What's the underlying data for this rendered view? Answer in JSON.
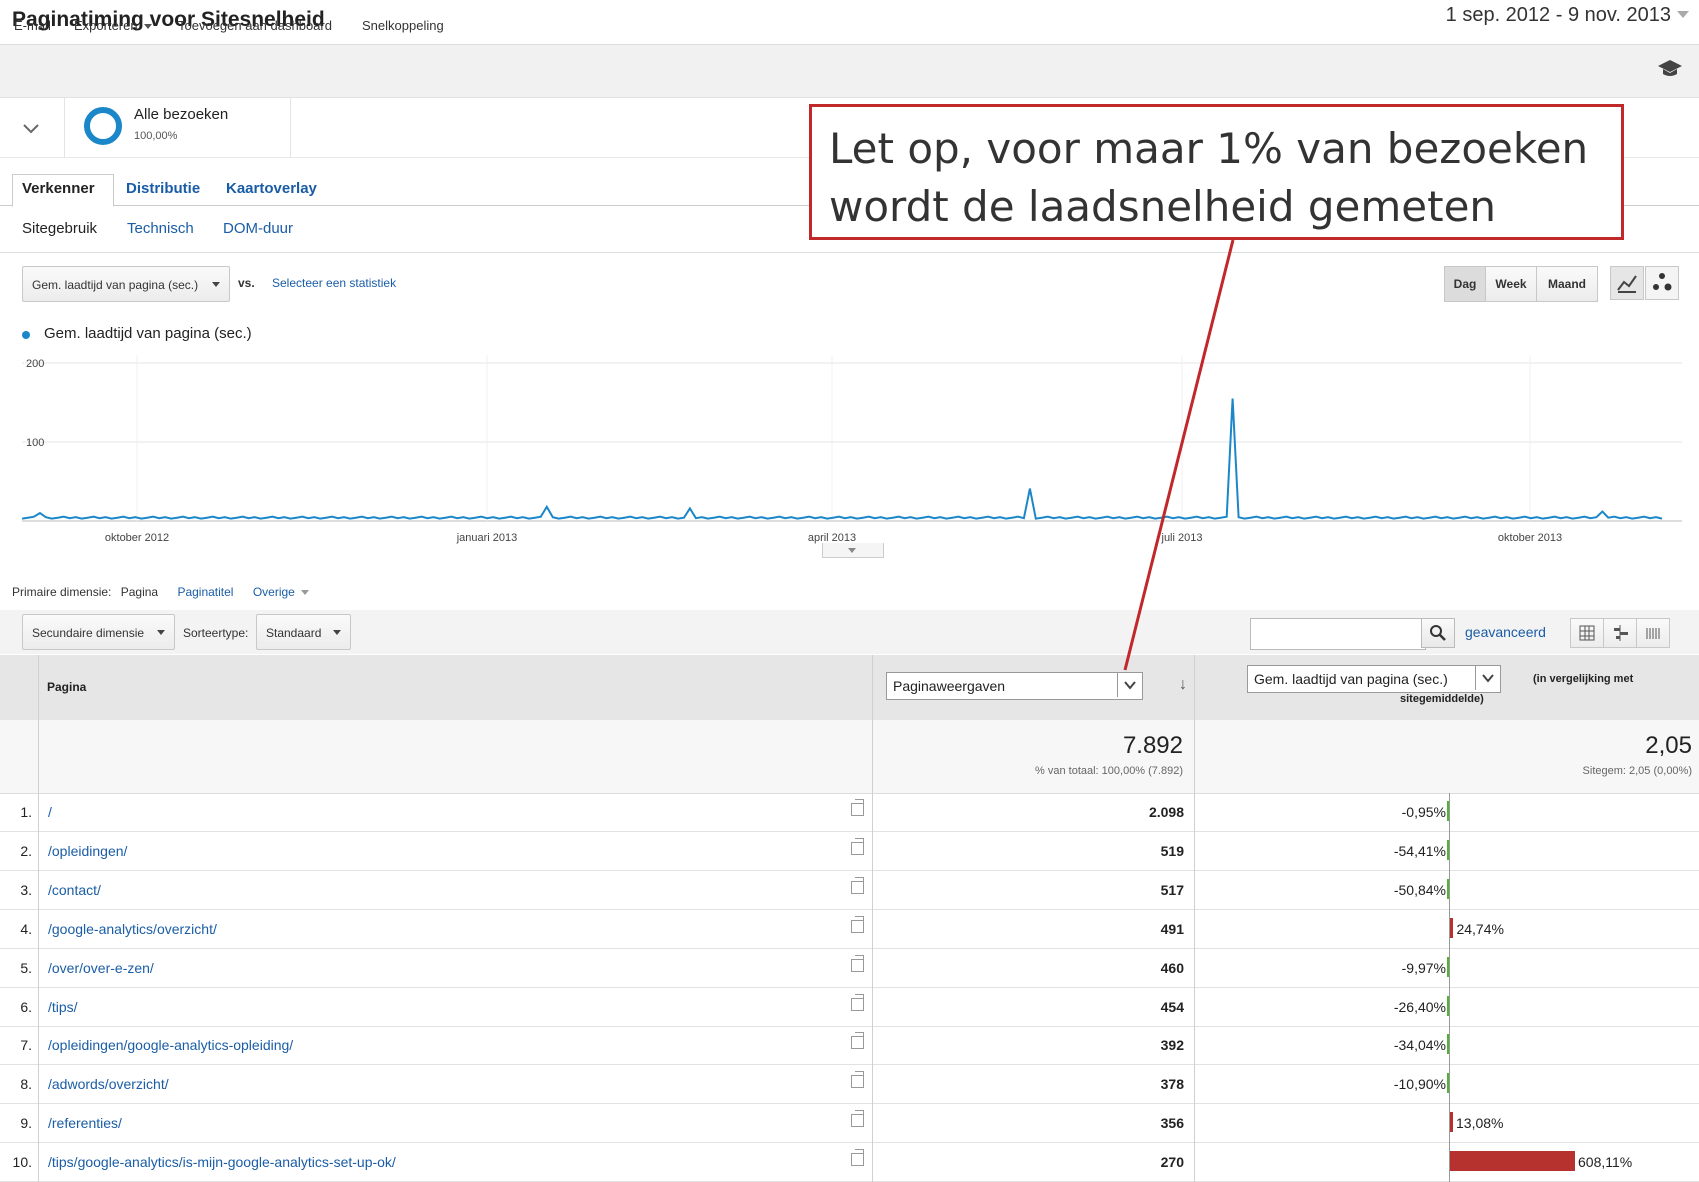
{
  "header": {
    "title": "Paginatiming voor Sitesnelheid",
    "date_range": "1 sep. 2012 - 9 nov. 2013"
  },
  "toolbar": {
    "email": "E-mail",
    "export": "Exporteren",
    "add_dashboard": "Toevoegen aan dashboard",
    "shortcut": "Snelkoppeling",
    "icon": "graduation-cap-icon"
  },
  "segment": {
    "name": "Alle bezoeken",
    "percent": "100,00%",
    "color": "#1b87c9"
  },
  "tabs": [
    "Verkenner",
    "Distributie",
    "Kaartoverlay"
  ],
  "subtabs": [
    "Sitegebruik",
    "Technisch",
    "DOM-duur"
  ],
  "chart_controls": {
    "metric": "Gem. laadtijd van pagina (sec.)",
    "vs": "vs.",
    "select_stat": "Selecteer een statistiek",
    "periods": [
      "Dag",
      "Week",
      "Maand"
    ],
    "active_period": "Dag"
  },
  "chart_data": {
    "type": "line",
    "series": [
      {
        "name": "Gem. laadtijd van pagina (sec.)",
        "color": "#1b87c9"
      }
    ],
    "yticks": [
      "200",
      "100"
    ],
    "ylim": [
      0,
      200
    ],
    "xlabels": [
      "oktober 2012",
      "januari 2013",
      "april 2013",
      "juli 2013",
      "oktober 2013"
    ],
    "baseline": 3,
    "spikes": [
      {
        "day": 16,
        "value": 10
      },
      {
        "day": 530,
        "value": 18
      },
      {
        "day": 672,
        "value": 16
      },
      {
        "day": 1012,
        "value": 41
      },
      {
        "day": 1217,
        "value": 155
      },
      {
        "day": 1592,
        "value": 12
      }
    ],
    "days": 1650
  },
  "dimensions": {
    "label": "Primaire dimensie:",
    "items": [
      "Pagina",
      "Paginatitel",
      "Overige"
    ]
  },
  "table_controls": {
    "secondary": "Secundaire dimensie",
    "sort_label": "Sorteertype:",
    "sort_value": "Standaard",
    "advanced": "geavanceerd"
  },
  "table": {
    "col_page": "Pagina",
    "col_pv": "Paginaweergaven",
    "col_lt": "Gem. laadtijd van pagina (sec.)",
    "col_lt_note": "(in vergelijking met",
    "col_lt_note2": "sitegemiddelde)",
    "total_pv": "7.892",
    "total_pv_sub": "% van totaal: 100,00% (7.892)",
    "total_lt": "2,05",
    "total_lt_sub": "Sitegem: 2,05 (0,00%)",
    "rows": [
      {
        "n": "1.",
        "page": "/",
        "pv": "2.098",
        "cmp": "-0,95%",
        "val": -0.95
      },
      {
        "n": "2.",
        "page": "/opleidingen/",
        "pv": "519",
        "cmp": "-54,41%",
        "val": -54.41
      },
      {
        "n": "3.",
        "page": "/contact/",
        "pv": "517",
        "cmp": "-50,84%",
        "val": -50.84
      },
      {
        "n": "4.",
        "page": "/google-analytics/overzicht/",
        "pv": "491",
        "cmp": "24,74%",
        "val": 24.74
      },
      {
        "n": "5.",
        "page": "/over/over-e-zen/",
        "pv": "460",
        "cmp": "-9,97%",
        "val": -9.97
      },
      {
        "n": "6.",
        "page": "/tips/",
        "pv": "454",
        "cmp": "-26,40%",
        "val": -26.4
      },
      {
        "n": "7.",
        "page": "/opleidingen/google-analytics-opleiding/",
        "pv": "392",
        "cmp": "-34,04%",
        "val": -34.04
      },
      {
        "n": "8.",
        "page": "/adwords/overzicht/",
        "pv": "378",
        "cmp": "-10,90%",
        "val": -10.9
      },
      {
        "n": "9.",
        "page": "/referenties/",
        "pv": "356",
        "cmp": "13,08%",
        "val": 13.08
      },
      {
        "n": "10.",
        "page": "/tips/google-analytics/is-mijn-google-analytics-set-up-ok/",
        "pv": "270",
        "cmp": "608,11%",
        "val": 608.11
      }
    ],
    "neg_color": "#50b432",
    "pos_color": "#b5322e"
  },
  "callout": {
    "text": "Let op, voor maar 1% van bezoeken wordt de laadsnelheid gemeten",
    "color": "#c0282a"
  }
}
